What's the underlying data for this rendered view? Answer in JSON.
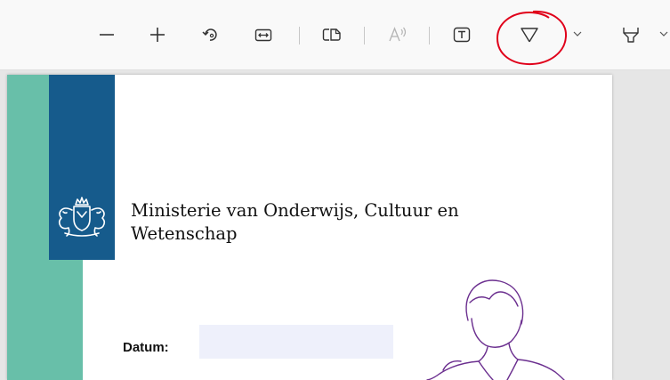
{
  "toolbar": {
    "buttons": [
      {
        "name": "zoom-out",
        "icon": "minus-icon"
      },
      {
        "name": "zoom-in",
        "icon": "plus-icon"
      },
      {
        "name": "rotate",
        "icon": "rotate-icon"
      },
      {
        "name": "fit-width",
        "icon": "fit-width-icon"
      },
      {
        "name": "page-view",
        "icon": "page-view-icon"
      },
      {
        "name": "read-aloud",
        "icon": "read-aloud-icon"
      },
      {
        "name": "text-box",
        "icon": "text-box-icon"
      },
      {
        "name": "draw",
        "icon": "pen-icon"
      },
      {
        "name": "highlight",
        "icon": "highlighter-icon"
      }
    ],
    "annotation_color": "#e0001a"
  },
  "document": {
    "ministry_line1": "Ministerie van Onderwijs, Cultuur en",
    "ministry_line2": "Wetenschap",
    "date_label": "Datum:",
    "date_value": "",
    "colors": {
      "teal_band": "#68bfa9",
      "blue_band": "#165b8c",
      "date_field": "#eef0fb",
      "sketch_stroke": "#6b2f8f"
    }
  }
}
